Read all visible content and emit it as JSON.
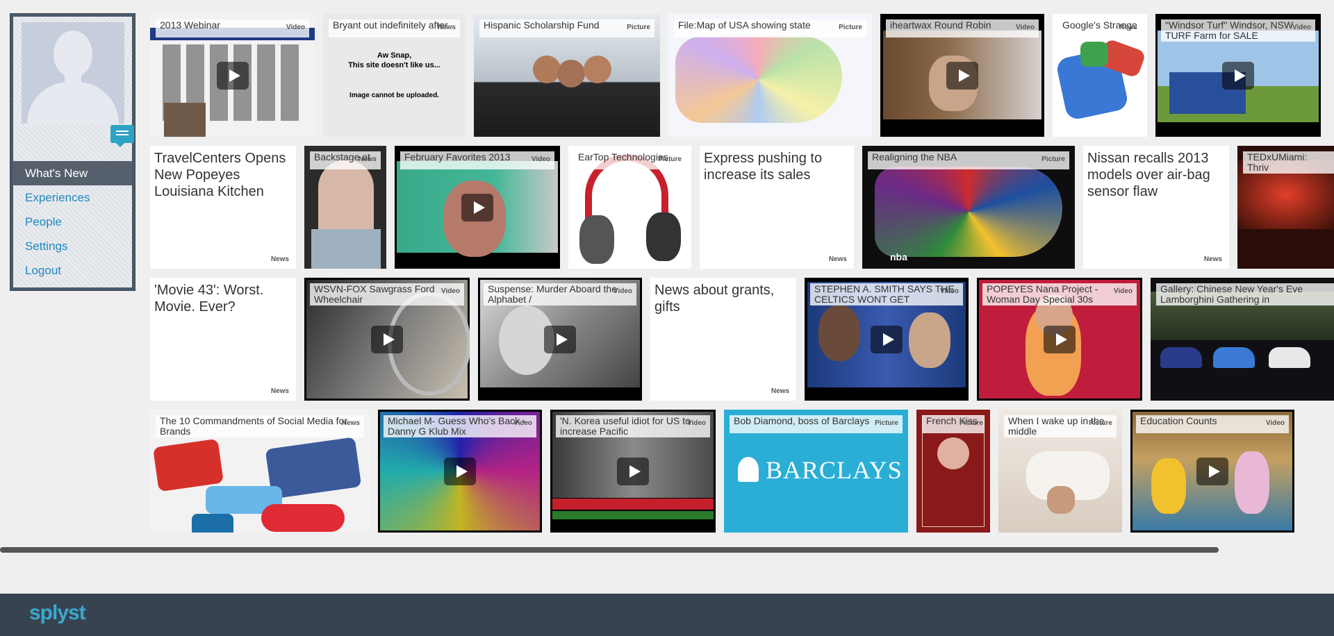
{
  "sidebar": {
    "nav": [
      {
        "label": "What's New",
        "active": true
      },
      {
        "label": "Experiences"
      },
      {
        "label": "People"
      },
      {
        "label": "Settings"
      },
      {
        "label": "Logout"
      }
    ]
  },
  "tiles": {
    "t1": {
      "title": "2013 Webinar",
      "type": "Video"
    },
    "t2": {
      "title": "Bryant out indefinitely after",
      "type": "News",
      "line1": "Aw Snap,",
      "line2": "This site doesn't like us...",
      "line3": "Image cannot be uploaded."
    },
    "t3": {
      "title": "Hispanic Scholarship Fund",
      "type": "Picture"
    },
    "t4": {
      "title": "File:Map of USA showing state",
      "type": "Picture"
    },
    "t5": {
      "title": "iheartwax Round Robin",
      "type": "Video"
    },
    "t6": {
      "title": "Google's Strange",
      "type": "News"
    },
    "t7": {
      "title": "\"Windsor Turf\" Windsor, NSW TURF Farm for SALE",
      "type": "Video"
    },
    "t8": {
      "title": "TravelCenters Opens New Popeyes Louisiana Kitchen",
      "type": "News"
    },
    "t9": {
      "title": "Backstage at",
      "type": "News"
    },
    "t10": {
      "title": "February Favorites 2013",
      "type": "Video"
    },
    "t11": {
      "title": "EarTop Technologies,",
      "type": "Picture"
    },
    "t12": {
      "title": "Express pushing to increase its sales",
      "type": "News"
    },
    "t13": {
      "title": "Realigning the NBA",
      "type": "Picture",
      "caption": "nba"
    },
    "t14": {
      "title": "Nissan recalls 2013 models over air-bag sensor flaw",
      "type": "News"
    },
    "t15": {
      "title": "TEDxUMiami: Thriv",
      "type": ""
    },
    "t16": {
      "title": "'Movie 43': Worst. Movie. Ever?",
      "type": "News"
    },
    "t17": {
      "title": "WSVN-FOX Sawgrass Ford Wheelchair",
      "type": "Video"
    },
    "t18": {
      "title": "Suspense: Murder Aboard the Alphabet /",
      "type": "Video"
    },
    "t19": {
      "title": "News about grants, gifts",
      "type": "News"
    },
    "t20": {
      "title": "STEPHEN A. SMITH SAYS THE CELTICS WONT GET",
      "type": "Video"
    },
    "t21": {
      "title": "POPEYES Nana Project - Woman Day Special 30s",
      "type": "Video"
    },
    "t22": {
      "title": "Gallery: Chinese New Year's Eve Lamborghini Gathering in",
      "type": ""
    },
    "t23": {
      "title": "The 10 Commandments of Social Media for Brands",
      "type": "News"
    },
    "t24": {
      "title": "Michael M- Guess Who's Back - Danny G Klub Mix",
      "type": "Video"
    },
    "t25": {
      "title": "'N. Korea useful idiot for US to increase Pacific",
      "type": "Video"
    },
    "t26": {
      "title": "Bob Diamond, boss of Barclays",
      "type": "Picture",
      "brand": "BARCLAYS"
    },
    "t27": {
      "title": "French Kiss",
      "type": "Picture"
    },
    "t28": {
      "title": "When I wake up in the middle",
      "type": "Picture"
    },
    "t29": {
      "title": "Education Counts",
      "type": "Video"
    }
  },
  "footer": {
    "logo": "splyst"
  }
}
